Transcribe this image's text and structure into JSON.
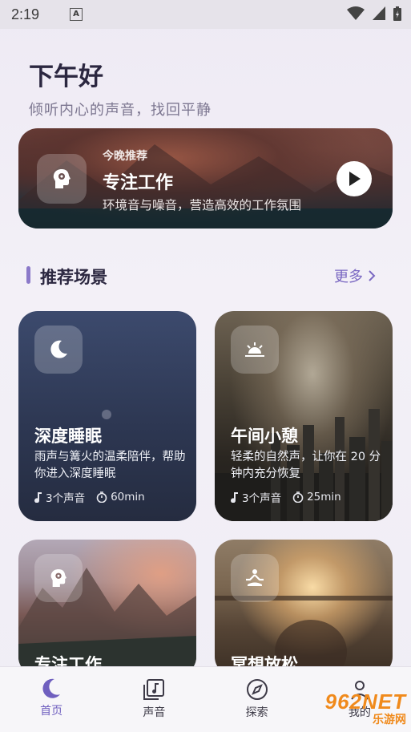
{
  "status_bar": {
    "time": "2:19",
    "notification_letter": "A"
  },
  "header": {
    "greeting": "下午好",
    "subtitle": "倾听内心的声音，找回平静"
  },
  "hero": {
    "kicker": "今晚推荐",
    "title": "专注工作",
    "description": "环境音与噪音，营造高效的工作氛围",
    "icon": "head-gear-icon",
    "play_icon": "play-icon"
  },
  "section": {
    "title": "推荐场景",
    "more_label": "更多"
  },
  "cards": [
    {
      "title": "深度睡眠",
      "description": "雨声与篝火的温柔陪伴，帮助你进入深度睡眠",
      "sounds": "3个声音",
      "duration": "60min",
      "icon": "moon-icon"
    },
    {
      "title": "午间小憩",
      "description": "轻柔的自然声，让你在 20 分钟内充分恢复",
      "sounds": "3个声音",
      "duration": "25min",
      "icon": "sunrise-icon"
    },
    {
      "title": "专注工作",
      "icon": "head-gear-icon"
    },
    {
      "title": "冥想放松",
      "icon": "meditation-icon"
    }
  ],
  "tabs": [
    {
      "label": "首页",
      "icon": "moon-icon",
      "active": true
    },
    {
      "label": "声音",
      "icon": "music-note-icon",
      "active": false
    },
    {
      "label": "探索",
      "icon": "compass-icon",
      "active": false
    },
    {
      "label": "我的",
      "icon": "person-icon",
      "active": false
    }
  ],
  "watermark": {
    "brand": "962NET",
    "sub": "乐游网"
  },
  "colors": {
    "accent": "#7a68c2",
    "bar": "#8b79c9",
    "title": "#2b2740"
  }
}
